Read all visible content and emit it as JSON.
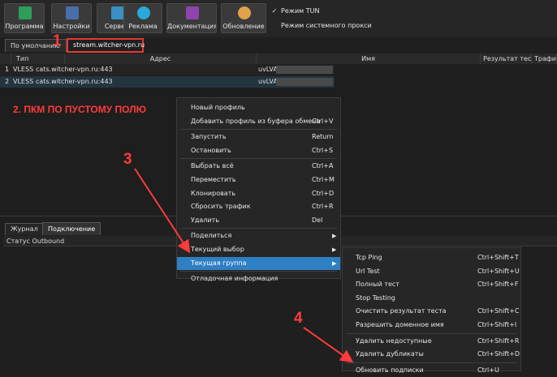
{
  "toolbar": {
    "buttons": [
      {
        "label": "Программа",
        "icon": "program-icon",
        "color": "#2e9e5b"
      },
      {
        "label": "Настройки",
        "icon": "settings-icon",
        "color": "#4a6fa8"
      },
      {
        "label": "Сервер",
        "icon": "server-icon",
        "color": "#3a8fc4"
      },
      {
        "label": "Реклама",
        "icon": "globe-icon",
        "color": "#2aa8d8"
      },
      {
        "label": "Документация",
        "icon": "book-icon",
        "color": "#8e44ad"
      },
      {
        "label": "Обновление",
        "icon": "update-icon",
        "color": "#e0a24a"
      }
    ],
    "tun_mode": {
      "label": "Режим TUN",
      "checked": true
    },
    "system_proxy": {
      "label": "Режим системного прокси",
      "checked": false
    }
  },
  "group_tabs": {
    "default": "По умолчанию",
    "subscription": "stream.witcher-vpn.ru"
  },
  "table": {
    "headers": [
      "Тип",
      "Адрес",
      "Имя",
      "Результат теста",
      "Трафик"
    ],
    "rows": [
      {
        "num": "1",
        "type": "VLESS",
        "address": "cats.witcher-vpn.ru:443",
        "name": "uvLVA"
      },
      {
        "num": "2",
        "type": "VLESS",
        "address": "cats.witcher-vpn.ru:443",
        "name": "uvLVA"
      }
    ]
  },
  "bottom_tabs": {
    "log": "Журнал",
    "connection": "Подключение"
  },
  "status_header": "Статус Outbound",
  "context_menu": [
    {
      "label": "Новый профиль",
      "shortcut": ""
    },
    {
      "label": "Добавить профиль из буфера обмена",
      "shortcut": "Ctrl+V"
    },
    {
      "sep": true
    },
    {
      "label": "Запустить",
      "shortcut": "Return"
    },
    {
      "label": "Остановить",
      "shortcut": "Ctrl+S"
    },
    {
      "sep": true
    },
    {
      "label": "Выбрать всё",
      "shortcut": "Ctrl+A"
    },
    {
      "label": "Переместить",
      "shortcut": "Ctrl+M"
    },
    {
      "label": "Клонировать",
      "shortcut": "Ctrl+D"
    },
    {
      "label": "Сбросить трафик",
      "shortcut": "Ctrl+R"
    },
    {
      "label": "Удалить",
      "shortcut": "Del"
    },
    {
      "sep": true
    },
    {
      "label": "Поделиться",
      "shortcut": "",
      "arrow": true
    },
    {
      "label": "Текущий выбор",
      "shortcut": "",
      "arrow": true
    },
    {
      "label": "Текущая группа",
      "shortcut": "",
      "arrow": true,
      "highlight": true
    },
    {
      "sep": true
    },
    {
      "label": "Отладочная информация",
      "shortcut": ""
    }
  ],
  "submenu": [
    {
      "label": "Tcp Ping",
      "shortcut": "Ctrl+Shift+T"
    },
    {
      "label": "Url Test",
      "shortcut": "Ctrl+Shift+U"
    },
    {
      "label": "Полный тест",
      "shortcut": "Ctrl+Shift+F"
    },
    {
      "label": "Stop Testing",
      "shortcut": ""
    },
    {
      "label": "Очистить результат теста",
      "shortcut": "Ctrl+Shift+C"
    },
    {
      "label": "Разрешить доменное имя",
      "shortcut": "Ctrl+Shift+I"
    },
    {
      "sep": true
    },
    {
      "label": "Удалить недоступные",
      "shortcut": "Ctrl+Shift+R"
    },
    {
      "label": "Удалить дубликаты",
      "shortcut": "Ctrl+Shift+D"
    },
    {
      "sep": true
    },
    {
      "label": "Обновить подписки",
      "shortcut": "Ctrl+U"
    }
  ],
  "annotations": {
    "n1": "1",
    "step2": "2. ПКМ ПО ПУСТОМУ ПОЛЮ",
    "n3": "3",
    "n4": "4",
    "color": "#ff3b3b"
  }
}
